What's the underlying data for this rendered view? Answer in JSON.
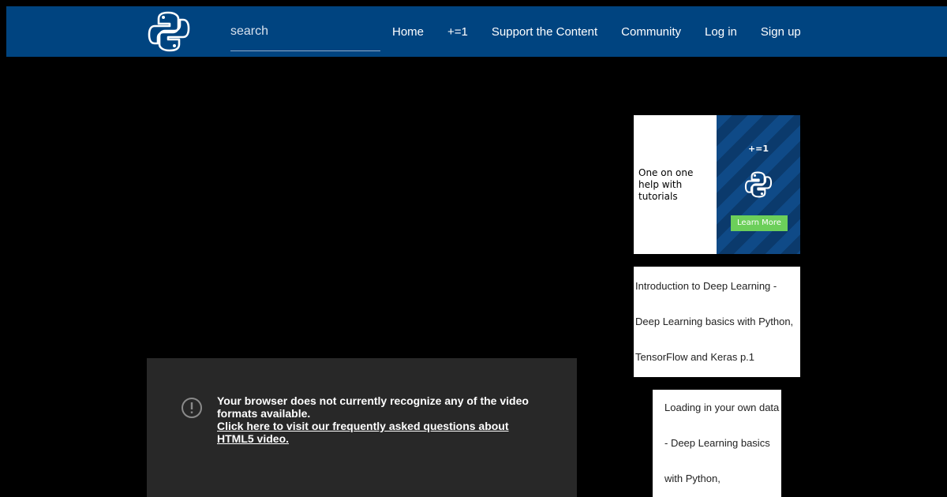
{
  "navbar": {
    "logo_icon": "python-logo-icon",
    "search": {
      "placeholder": "search",
      "value": ""
    },
    "links": [
      "Home",
      "+=1",
      "Support the Content",
      "Community",
      "Log in",
      "Sign up"
    ]
  },
  "video": {
    "alert_icon": "exclamation-circle-icon",
    "message": "Your browser does not currently recognize any of the video formats available.",
    "link_text": "Click here to visit our frequently asked questions about HTML5 video."
  },
  "ad": {
    "text": "One on one help with tutorials",
    "brand": "+=1",
    "logo_icon": "python-logo-icon",
    "button_label": "Learn More"
  },
  "tutorials": [
    {
      "title": "Introduction to Deep Learning - Deep Learning basics with Python, TensorFlow and Keras p.1"
    },
    {
      "title": "Loading in your own data - Deep Learning basics with Python,"
    }
  ],
  "colors": {
    "nav_bg": "#004480",
    "page_bg": "#000000",
    "video_bg": "#282828",
    "ad_button": "#6ccf5a"
  }
}
